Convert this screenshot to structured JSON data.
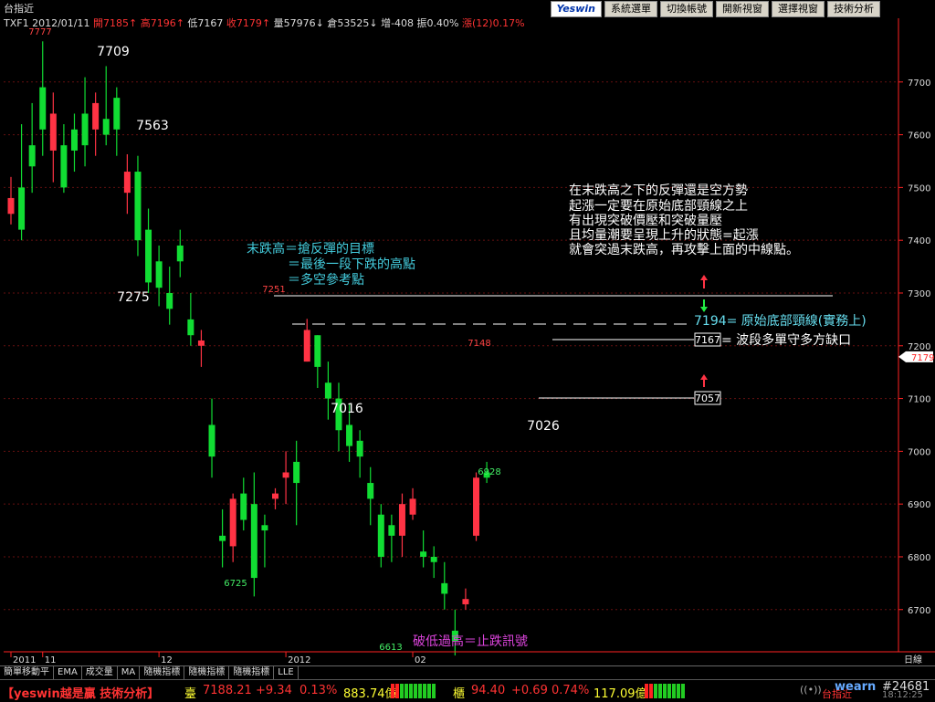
{
  "window": {
    "title": "台指近",
    "toolbar": {
      "logo": "Yeswin",
      "buttons": [
        "系統選單",
        "切換帳號",
        "開新視窗",
        "選擇視窗",
        "技術分析"
      ]
    }
  },
  "quote_line": [
    {
      "text": "TXF1",
      "color": "#dddddd"
    },
    {
      "text": "2012/01/11",
      "color": "#dddddd"
    },
    {
      "text": "開7185↑",
      "color": "#ff3333"
    },
    {
      "text": "高7196↑",
      "color": "#ff3333"
    },
    {
      "text": "低7167",
      "color": "#dddddd"
    },
    {
      "text": "收7179↑",
      "color": "#ff3333"
    },
    {
      "text": "量57976↓",
      "color": "#dddddd"
    },
    {
      "text": "倉53525↓",
      "color": "#dddddd"
    },
    {
      "text": "增-408",
      "color": "#dddddd"
    },
    {
      "text": "振0.40%",
      "color": "#dddddd"
    },
    {
      "text": "漲(12)0.17%",
      "color": "#ff3333"
    }
  ],
  "chart_data": {
    "type": "candlestick",
    "ylim": [
      6620,
      7800
    ],
    "y_ticks": [
      6700,
      6800,
      6900,
      7000,
      7100,
      7200,
      7300,
      7400,
      7500,
      7600,
      7700
    ],
    "x_labels": [
      {
        "index": 0,
        "label": "2011"
      },
      {
        "index": 3,
        "label": "11"
      },
      {
        "index": 14,
        "label": "12"
      },
      {
        "index": 26,
        "label": "2012"
      },
      {
        "index": 38,
        "label": "02"
      }
    ],
    "x_axis_unit": "日線",
    "last_price": 7179,
    "colors": {
      "up": "#ff3344",
      "down": "#11dd33",
      "grid": "#661111",
      "axis": "#ff2222"
    },
    "candles": [
      [
        7450,
        7520,
        7430,
        7480
      ],
      [
        7500,
        7620,
        7400,
        7420
      ],
      [
        7580,
        7660,
        7490,
        7540
      ],
      [
        7690,
        7777,
        7560,
        7610
      ],
      [
        7570,
        7680,
        7510,
        7640
      ],
      [
        7580,
        7620,
        7490,
        7500
      ],
      [
        7610,
        7640,
        7530,
        7570
      ],
      [
        7640,
        7709,
        7540,
        7580
      ],
      [
        7610,
        7680,
        7560,
        7660
      ],
      [
        7630,
        7730,
        7580,
        7600
      ],
      [
        7670,
        7690,
        7560,
        7610
      ],
      [
        7490,
        7563,
        7450,
        7530
      ],
      [
        7530,
        7560,
        7370,
        7400
      ],
      [
        7420,
        7460,
        7300,
        7320
      ],
      [
        7360,
        7390,
        7275,
        7310
      ],
      [
        7300,
        7350,
        7240,
        7270
      ],
      [
        7390,
        7420,
        7330,
        7360
      ],
      [
        7250,
        7300,
        7200,
        7220
      ],
      [
        7200,
        7230,
        7160,
        7210
      ],
      [
        7050,
        7100,
        6950,
        6990
      ],
      [
        6840,
        6890,
        6780,
        6830
      ],
      [
        6820,
        6920,
        6790,
        6910
      ],
      [
        6920,
        6950,
        6850,
        6870
      ],
      [
        6900,
        6960,
        6725,
        6760
      ],
      [
        6860,
        6880,
        6780,
        6850
      ],
      [
        6910,
        6930,
        6890,
        6920
      ],
      [
        6950,
        7000,
        6900,
        6960
      ],
      [
        6980,
        7020,
        6860,
        6940
      ],
      [
        7170,
        7251,
        7170,
        7230
      ],
      [
        7220,
        7220,
        7120,
        7160
      ],
      [
        7130,
        7170,
        7060,
        7100
      ],
      [
        7100,
        7130,
        7000,
        7040
      ],
      [
        7050,
        7090,
        6980,
        7010
      ],
      [
        7020,
        7040,
        6950,
        6990
      ],
      [
        6940,
        6970,
        6860,
        6910
      ],
      [
        6880,
        6900,
        6780,
        6800
      ],
      [
        6860,
        6880,
        6790,
        6840
      ],
      [
        6840,
        6920,
        6800,
        6900
      ],
      [
        6880,
        6930,
        6870,
        6910
      ],
      [
        6810,
        6850,
        6780,
        6800
      ],
      [
        6800,
        6820,
        6760,
        6790
      ],
      [
        6750,
        6790,
        6700,
        6730
      ],
      [
        6660,
        6700,
        6613,
        6640
      ],
      [
        6710,
        6740,
        6700,
        6720
      ],
      [
        6840,
        6960,
        6830,
        6950
      ],
      [
        6960,
        6980,
        6940,
        6950
      ]
    ]
  },
  "annotations": {
    "labels": {
      "l7777": "7777",
      "l7709": "7709",
      "l7563": "7563",
      "l7275": "7275",
      "l6725": "6725",
      "l7251": "7251",
      "l7016": "7016",
      "l6613": "6613",
      "l7148": "7148",
      "l6928": "6928",
      "l7026": "7026"
    },
    "cyan_note": [
      "末跌高＝搶反彈的目標",
      "＝最後一段下跌的高點",
      "＝多空參考點"
    ],
    "white_note": [
      "在末跌高之下的反彈還是空方勢",
      "起漲一定要在原始底部頸線之上",
      "有出現突破價壓和突破量壓",
      "且均量潮要呈現上升的狀態=起漲",
      "就會突過末跌高，再攻擊上面的中線點。"
    ],
    "neckline_label": "7194= 原始底部頸線(實務上)",
    "box7167_value": "7167",
    "box7167_text": "= 波段多單守多方缺口",
    "box7057_value": "7057",
    "stop_note": "破低過高＝止跌訊號"
  },
  "indicator_tabs": [
    "簡單移動平",
    "EMA",
    "成交量",
    "MA",
    "隨機指標",
    "隨機指標",
    "隨機指標",
    "LLE"
  ],
  "status_bar": {
    "brand": "【yeswin越是贏 技術分析】",
    "idx1_label": "臺",
    "idx1_price": "7188.21",
    "idx1_change": "+9.34",
    "idx1_pct": "0.13%",
    "idx1_vol": "883.74億",
    "idx2_label": "櫃",
    "idx2_price": "94.40",
    "idx2_change": "+0.69",
    "idx2_pct": "0.74%",
    "idx2_vol": "117.09億",
    "symbol": "台指近",
    "user": "wearn",
    "code": "#24681",
    "time": "18:12:25"
  }
}
